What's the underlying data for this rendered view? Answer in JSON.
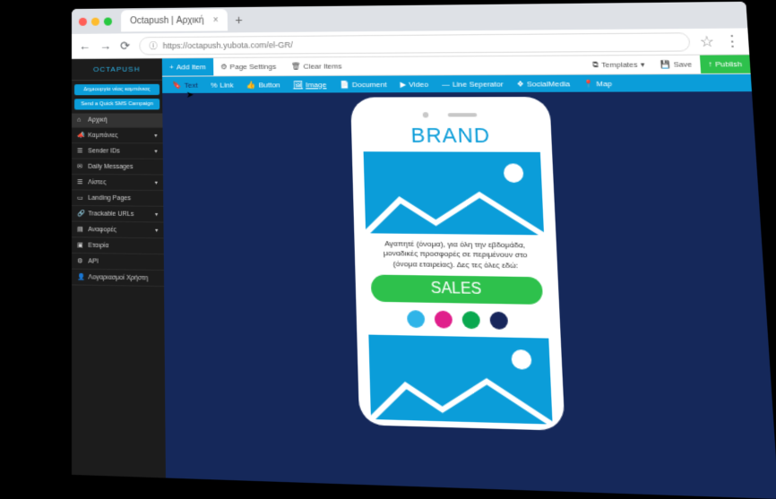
{
  "browser": {
    "tab_title": "Octapush | Αρχική",
    "url": "https://octapush.yubota.com/el-GR/"
  },
  "logo_text": "OCTAPUSH",
  "sidebar_buttons": {
    "b1": "Δημιουργία νέας καμπάνιας",
    "b2": "Send a Quick SMS Campaign"
  },
  "sidebar": [
    {
      "label": "Αρχική",
      "icon": "🏠"
    },
    {
      "label": "Καμπάνιες",
      "icon": "📣"
    },
    {
      "label": "Sender IDs",
      "icon": "🗂"
    },
    {
      "label": "Daily Messages",
      "icon": "✉"
    },
    {
      "label": "Λίστες",
      "icon": "📋"
    },
    {
      "label": "Landing Pages",
      "icon": "🔗"
    },
    {
      "label": "Trackable URLs",
      "icon": "🔗"
    },
    {
      "label": "Αναφορές",
      "icon": "📊"
    },
    {
      "label": "Εταιρία",
      "icon": "🏢"
    },
    {
      "label": "API",
      "icon": "⚙"
    },
    {
      "label": "Λογαριασμοί Χρήστη",
      "icon": "👤"
    }
  ],
  "actionbar": {
    "add": "Add Item",
    "page_settings": "Page Settings",
    "clear": "Clear Items",
    "templates": "Templates",
    "save": "Save",
    "publish": "Publish"
  },
  "toolbar": [
    {
      "label": "Text",
      "icon": "🔖"
    },
    {
      "label": "Link",
      "icon": "🔗"
    },
    {
      "label": "Button",
      "icon": "👍"
    },
    {
      "label": "Image",
      "icon": "🖼"
    },
    {
      "label": "Document",
      "icon": "📄"
    },
    {
      "label": "Video",
      "icon": "▶"
    },
    {
      "label": "Line Seperator",
      "icon": "—"
    },
    {
      "label": "SocialMedia",
      "icon": "❖"
    },
    {
      "label": "Map",
      "icon": "📍"
    }
  ],
  "mock": {
    "brand": "BRAND",
    "paragraph": "Αγαπητέ (όνομα), για όλη την εβδομάδα, μοναδικές προσφορές σε περιμένουν στο (όνομα εταιρείας). Δες τες όλες εδώ:",
    "cta": "SALES",
    "swatches": [
      "#2fb4e8",
      "#e01f8b",
      "#0aa84f",
      "#17265b"
    ]
  }
}
